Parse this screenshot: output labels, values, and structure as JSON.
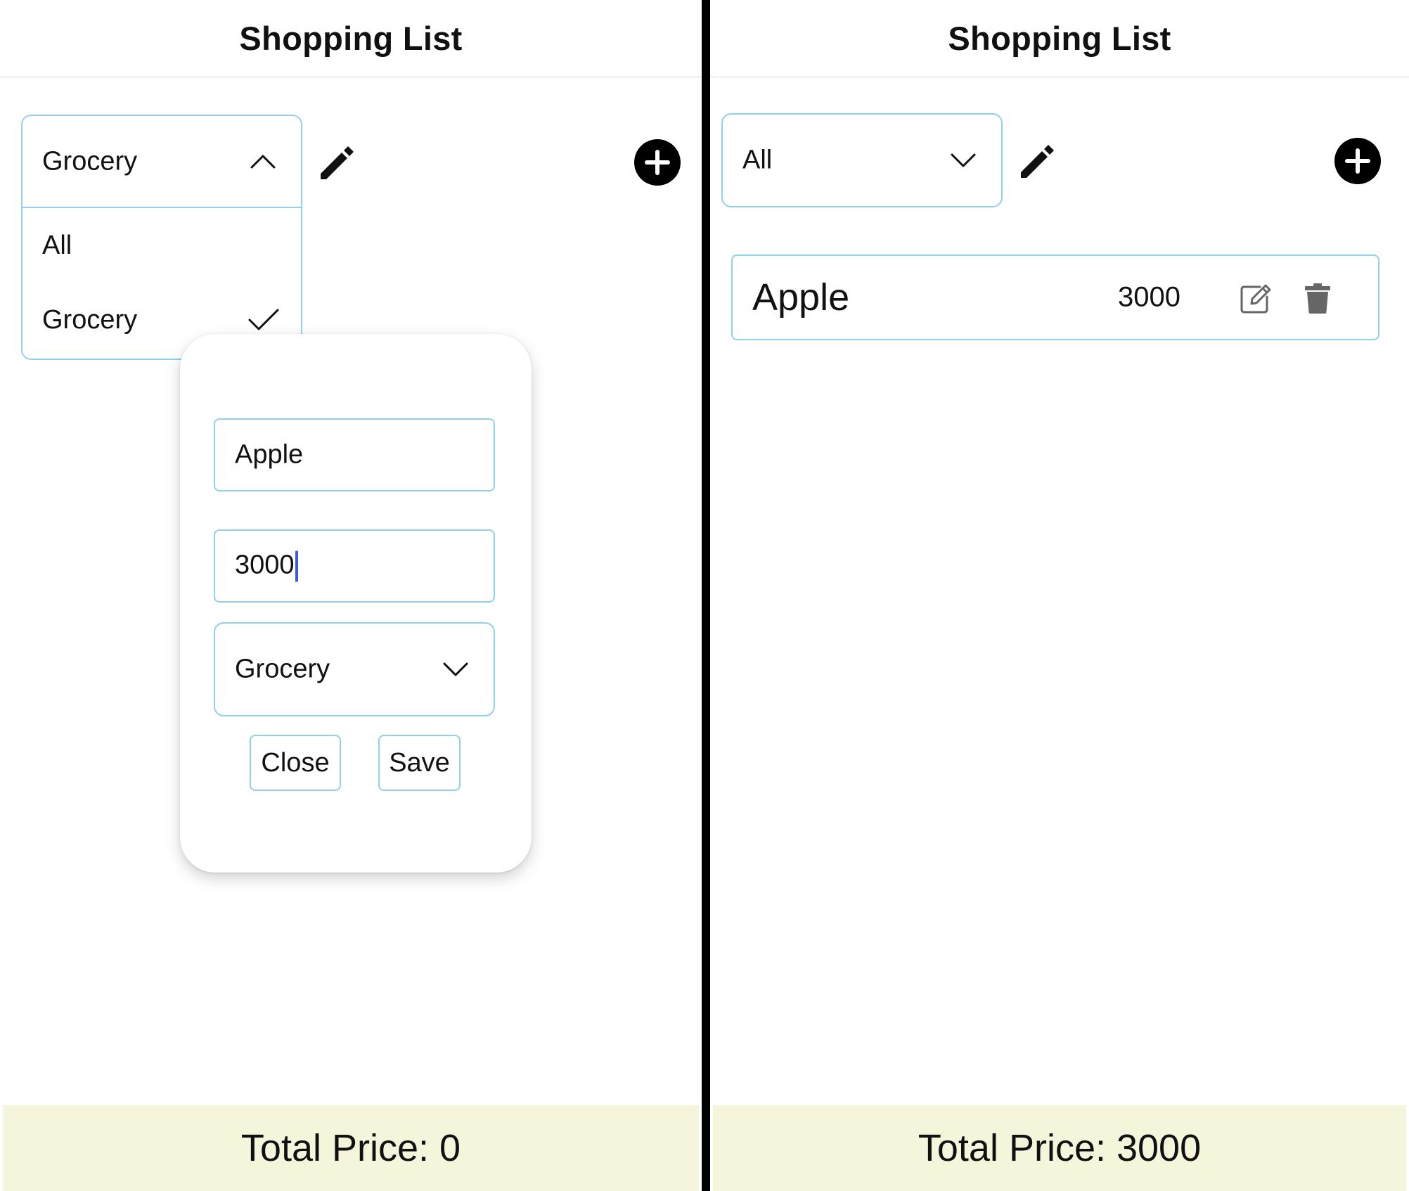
{
  "left_screen": {
    "header": {
      "title": "Shopping List"
    },
    "category_filter": {
      "value": "Grocery",
      "expanded": true
    },
    "dropdown_options": [
      {
        "label": "All",
        "selected": false
      },
      {
        "label": "Grocery",
        "selected": true
      }
    ],
    "modal": {
      "name_value": "Apple",
      "price_value": "3000",
      "category_value": "Grocery",
      "close_label": "Close",
      "save_label": "Save"
    },
    "footer": {
      "total_label": "Total Price: 0"
    }
  },
  "right_screen": {
    "header": {
      "title": "Shopping List"
    },
    "category_filter": {
      "value": "All",
      "expanded": false
    },
    "items": [
      {
        "name": "Apple",
        "price": "3000"
      }
    ],
    "footer": {
      "total_label": "Total Price: 3000"
    }
  },
  "icons": {
    "edit_category": "pencil-icon",
    "add_item": "plus-circle-icon",
    "edit_item": "edit-square-icon",
    "delete_item": "trash-icon",
    "dropdown_open": "chevron-up-icon",
    "dropdown_closed": "chevron-down-icon",
    "selected_option": "checkmark-icon"
  },
  "colors": {
    "accent_border": "#8fd3e8",
    "footer_background": "#f5f5dc",
    "caret": "#3b5bdb",
    "divider": "#000000"
  }
}
